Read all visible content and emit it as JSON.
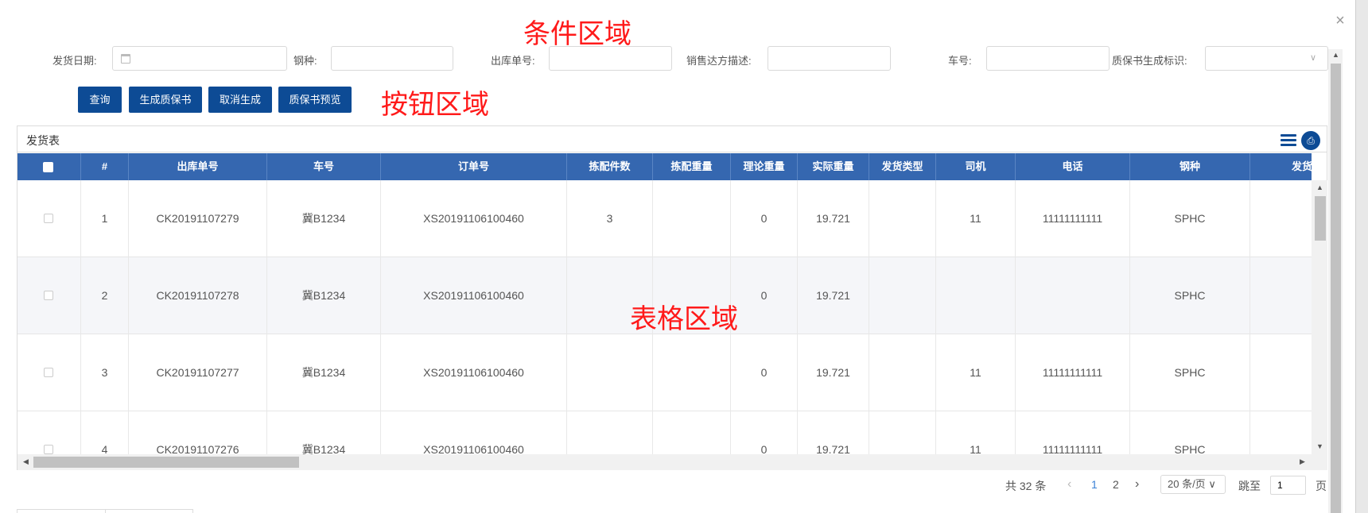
{
  "dialog": {
    "close_icon": "close-icon"
  },
  "annotations": {
    "conditions": "条件区域",
    "buttons": "按钮区域",
    "table": "表格区域"
  },
  "filters": {
    "ship_date": {
      "label": "发货日期:",
      "value": ""
    },
    "steel_grade": {
      "label": "钢种:",
      "value": ""
    },
    "outbound_no": {
      "label": "出库单号:",
      "value": ""
    },
    "sales_desc": {
      "label": "销售达方描述:",
      "value": ""
    },
    "vehicle_no": {
      "label": "车号:",
      "value": ""
    },
    "cert_flag": {
      "label": "质保书生成标识:",
      "value": ""
    }
  },
  "buttons": {
    "query": "查询",
    "generate_cert": "生成质保书",
    "cancel_generate": "取消生成",
    "cert_preview": "质保书预览"
  },
  "grid": {
    "caption": "发货表",
    "columns": [
      "#",
      "出库单号",
      "车号",
      "订单号",
      "拣配件数",
      "拣配重量",
      "理论重量",
      "实际重量",
      "发货类型",
      "司机",
      "电话",
      "钢种",
      "发货日期"
    ],
    "rows": [
      {
        "num": "1",
        "outbound": "CK20191107279",
        "vehicle": "冀B1234",
        "order": "XS20191106100460",
        "pick_count": "3",
        "pick_weight": "",
        "theory_weight": "0",
        "actual_weight": "19.721",
        "ship_type": "",
        "driver": "11",
        "phone": "11111111111",
        "grade": "SPHC",
        "date": ""
      },
      {
        "num": "2",
        "outbound": "CK20191107278",
        "vehicle": "冀B1234",
        "order": "XS20191106100460",
        "pick_count": "",
        "pick_weight": "",
        "theory_weight": "0",
        "actual_weight": "19.721",
        "ship_type": "",
        "driver": "",
        "phone": "",
        "grade": "SPHC",
        "date": ""
      },
      {
        "num": "3",
        "outbound": "CK20191107277",
        "vehicle": "冀B1234",
        "order": "XS20191106100460",
        "pick_count": "",
        "pick_weight": "",
        "theory_weight": "0",
        "actual_weight": "19.721",
        "ship_type": "",
        "driver": "11",
        "phone": "11111111111",
        "grade": "SPHC",
        "date": ""
      },
      {
        "num": "4",
        "outbound": "CK20191107276",
        "vehicle": "冀B1234",
        "order": "XS20191106100460",
        "pick_count": "",
        "pick_weight": "",
        "theory_weight": "0",
        "actual_weight": "19.721",
        "ship_type": "",
        "driver": "11",
        "phone": "11111111111",
        "grade": "SPHC",
        "date": ""
      }
    ]
  },
  "pagination": {
    "total": "共 32 条",
    "pages": [
      "1",
      "2"
    ],
    "current": "1",
    "page_size": "20 条/页",
    "jump_label": "跳至",
    "jump_value": "1",
    "page_suffix": "页"
  },
  "colors": {
    "header_bg": "#3567b0",
    "button_bg": "#0d4b95",
    "annotation": "#ff1a1a",
    "active_page": "#3b82d6"
  }
}
